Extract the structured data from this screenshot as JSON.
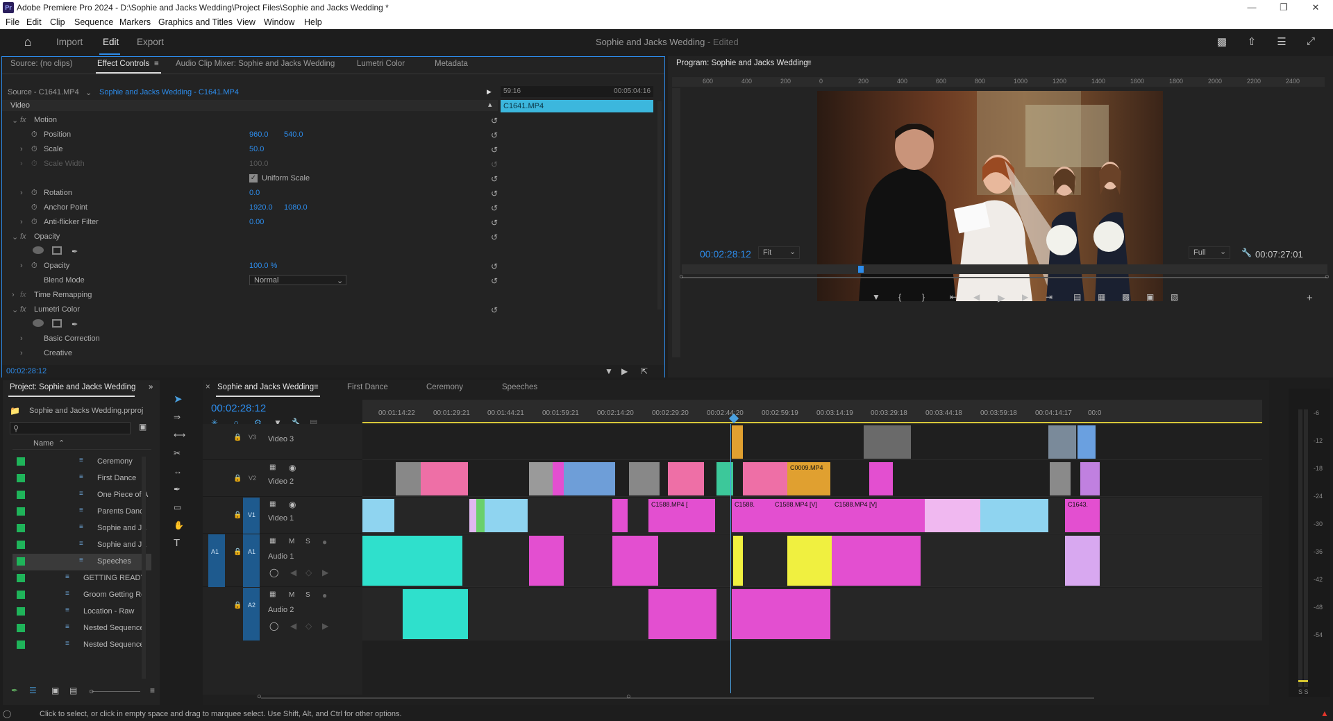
{
  "app": {
    "title": "Adobe Premiere Pro 2024 - D:\\Sophie and Jacks Wedding\\Project Files\\Sophie and Jacks Wedding *",
    "menu": [
      "File",
      "Edit",
      "Clip",
      "Sequence",
      "Markers",
      "Graphics and Titles",
      "View",
      "Window",
      "Help"
    ],
    "header_nav": [
      "Import",
      "Edit",
      "Export"
    ],
    "project_name": "Sophie and Jacks Wedding",
    "project_status": "- Edited"
  },
  "source_panel": {
    "tabs": [
      "Source: (no clips)",
      "Effect Controls",
      "Audio Clip Mixer: Sophie and Jacks Wedding",
      "Lumetri Color",
      "Metadata"
    ],
    "source_label": "Source - C1641.MP4",
    "sequence_clip": "Sophie and Jacks Wedding - C1641.MP4",
    "mini_tc_start": "59:16",
    "mini_tc_end": "00:05:04:16",
    "mini_clip": "C1641.MP4",
    "section_video": "Video",
    "effects": {
      "motion": "Motion",
      "position": "Position",
      "position_x": "960.0",
      "position_y": "540.0",
      "scale": "Scale",
      "scale_val": "50.0",
      "scale_width": "Scale Width",
      "scale_width_val": "100.0",
      "uniform_scale": "Uniform Scale",
      "rotation": "Rotation",
      "rotation_val": "0.0",
      "anchor": "Anchor Point",
      "anchor_x": "1920.0",
      "anchor_y": "1080.0",
      "antiflicker": "Anti-flicker Filter",
      "antiflicker_val": "0.00",
      "opacity_group": "Opacity",
      "opacity": "Opacity",
      "opacity_val": "100.0 %",
      "blend_mode": "Blend Mode",
      "blend_val": "Normal",
      "time_remap": "Time Remapping",
      "lumetri": "Lumetri Color",
      "basic_correction": "Basic Correction",
      "creative": "Creative"
    },
    "timecode": "00:02:28:12"
  },
  "program_monitor": {
    "title": "Program: Sophie and Jacks Wedding",
    "ruler_labels": [
      "600",
      "400",
      "200",
      "0",
      "200",
      "400",
      "600",
      "800",
      "1000",
      "1200",
      "1400",
      "1600",
      "1800",
      "2000",
      "2200",
      "2400"
    ],
    "timecode": "00:02:28:12",
    "fit": "Fit",
    "quality": "Full",
    "duration": "00:07:27:01"
  },
  "project_panel": {
    "title": "Project: Sophie and Jacks Wedding",
    "file": "Sophie and Jacks Wedding.prproj",
    "column": "Name",
    "items": [
      {
        "name": "Ceremony",
        "indent": 2
      },
      {
        "name": "First Dance",
        "indent": 2
      },
      {
        "name": "One Piece of A",
        "indent": 2
      },
      {
        "name": "Parents Danc",
        "indent": 2
      },
      {
        "name": "Sophie and Ja",
        "indent": 2
      },
      {
        "name": "Sophie and Ja",
        "indent": 2
      },
      {
        "name": "Speeches",
        "indent": 2,
        "selected": true
      },
      {
        "name": "GETTING READY",
        "indent": 1
      },
      {
        "name": "Groom Getting Re",
        "indent": 1
      },
      {
        "name": "Location - Raw",
        "indent": 1
      },
      {
        "name": "Nested Sequence",
        "indent": 1
      },
      {
        "name": "Nested Sequence",
        "indent": 1
      }
    ]
  },
  "timeline": {
    "tabs": [
      "Sophie and Jacks Wedding",
      "First Dance",
      "Ceremony",
      "Speeches"
    ],
    "timecode": "00:02:28:12",
    "ruler": [
      "00:01:14:22",
      "00:01:29:21",
      "00:01:44:21",
      "00:01:59:21",
      "00:02:14:20",
      "00:02:29:20",
      "00:02:44:20",
      "00:02:59:19",
      "00:03:14:19",
      "00:03:29:18",
      "00:03:44:18",
      "00:03:59:18",
      "00:04:14:17",
      "00:0"
    ],
    "tracks": {
      "v3": "Video 3",
      "v2": "Video 2",
      "v1": "Video 1",
      "a1": "Audio 1",
      "a2": "Audio 2",
      "v3_tag": "V3",
      "v2_tag": "V2",
      "v1_tag": "V1",
      "a1_tag": "A1",
      "a2_tag": "A2",
      "m": "M",
      "s": "S"
    },
    "clip_labels": [
      "C0009.MP4",
      "C1588.MP4 [",
      "C1588.",
      "C1588.MP4 [V]",
      "C1588.MP4 [V]",
      "C1643."
    ],
    "vu_scale": [
      "-6",
      "-12",
      "-18",
      "-24",
      "-30",
      "-36",
      "-42",
      "-48",
      "-54"
    ],
    "vu_footer": "S S"
  },
  "status": {
    "text": "Click to select, or click in empty space and drag to marquee select. Use Shift, Alt, and Ctrl for other options."
  }
}
